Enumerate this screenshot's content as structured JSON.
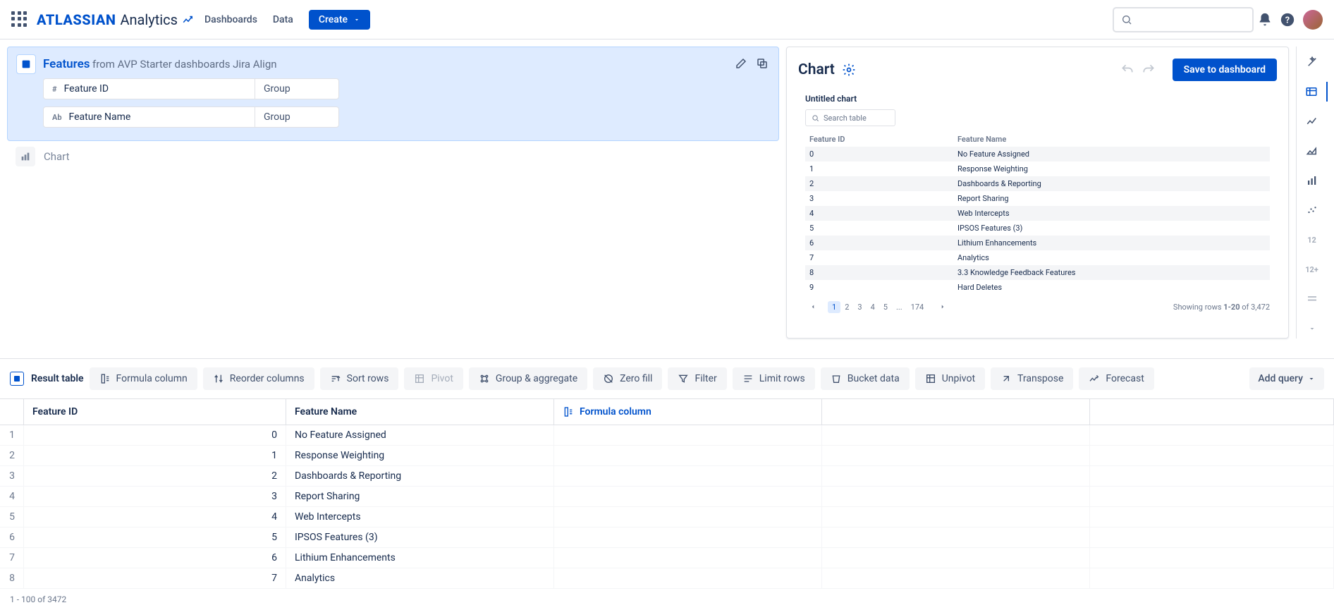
{
  "top": {
    "dashboards": "Dashboards",
    "data": "Data",
    "create": "Create",
    "brand": "ATLASSIAN",
    "sub": "Analytics"
  },
  "query": {
    "title": "Features",
    "from": "from AVP Starter dashboards Jira Align",
    "cols": [
      {
        "type": "#",
        "name": "Feature ID",
        "agg": "Group"
      },
      {
        "type": "Ab",
        "name": "Feature Name",
        "agg": "Group"
      }
    ],
    "chart_step": "Chart"
  },
  "chart": {
    "heading": "Chart",
    "save": "Save to dashboard",
    "title": "Untitled chart",
    "search_placeholder": "Search table",
    "headers": {
      "id": "Feature ID",
      "name": "Feature Name"
    },
    "rows": [
      {
        "id": "0",
        "name": "No Feature Assigned"
      },
      {
        "id": "1",
        "name": "Response Weighting"
      },
      {
        "id": "2",
        "name": "Dashboards & Reporting"
      },
      {
        "id": "3",
        "name": "Report Sharing"
      },
      {
        "id": "4",
        "name": "Web Intercepts"
      },
      {
        "id": "5",
        "name": "IPSOS Features (3)"
      },
      {
        "id": "6",
        "name": "Lithium Enhancements"
      },
      {
        "id": "7",
        "name": "Analytics"
      },
      {
        "id": "8",
        "name": "3.3 Knowledge Feedback Features"
      },
      {
        "id": "9",
        "name": "Hard Deletes"
      }
    ],
    "pages": [
      "1",
      "2",
      "3",
      "4",
      "5",
      "...",
      "174"
    ],
    "status_prefix": "Showing rows ",
    "status_range": "1-20",
    "status_of": " of 3,472"
  },
  "toolbar": {
    "result": "Result table",
    "formula": "Formula column",
    "reorder": "Reorder columns",
    "sort": "Sort rows",
    "pivot": "Pivot",
    "group": "Group & aggregate",
    "zero": "Zero fill",
    "filter": "Filter",
    "limit": "Limit rows",
    "bucket": "Bucket data",
    "unpivot": "Unpivot",
    "transpose": "Transpose",
    "forecast": "Forecast",
    "add_query": "Add query"
  },
  "result": {
    "h_id": "Feature ID",
    "h_name": "Feature Name",
    "h_formula": "Formula column",
    "rows": [
      {
        "n": "1",
        "id": "0",
        "name": "No Feature Assigned"
      },
      {
        "n": "2",
        "id": "1",
        "name": "Response Weighting"
      },
      {
        "n": "3",
        "id": "2",
        "name": "Dashboards & Reporting"
      },
      {
        "n": "4",
        "id": "3",
        "name": "Report Sharing"
      },
      {
        "n": "5",
        "id": "4",
        "name": "Web Intercepts"
      },
      {
        "n": "6",
        "id": "5",
        "name": "IPSOS Features (3)"
      },
      {
        "n": "7",
        "id": "6",
        "name": "Lithium Enhancements"
      },
      {
        "n": "8",
        "id": "7",
        "name": "Analytics"
      }
    ],
    "footer": "1 - 100 of 3472"
  },
  "rail": {
    "n12": "12",
    "n12p": "12+"
  }
}
